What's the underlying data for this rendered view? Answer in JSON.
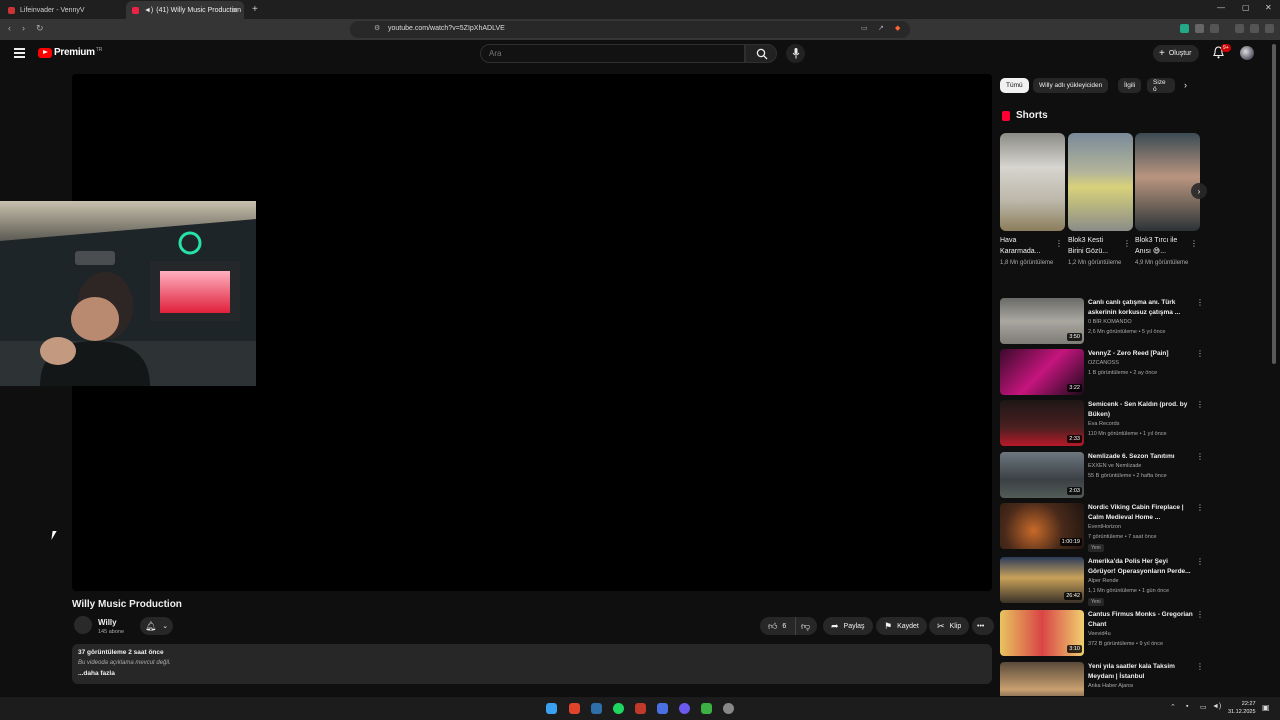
{
  "browser": {
    "tabs": [
      {
        "title": "Lifeinvader - VennyV"
      },
      {
        "title": "(41) Willy Music Production"
      }
    ],
    "url": "youtube.com/watch?v=5ZIpXhADLVE"
  },
  "header": {
    "logo": "Premium",
    "logo_region": "TR",
    "search_placeholder": "Ara",
    "create_label": "Oluştur",
    "notification_count": "9+"
  },
  "video": {
    "title": "Willy Music Production",
    "channel": "Willy",
    "subscribers": "145 abone",
    "likes": "6",
    "share_label": "Paylaş",
    "save_label": "Kaydet",
    "clip_label": "Klip",
    "description": {
      "views_date": "37 görüntüleme  2 saat önce",
      "text": "Bu videoda açıklama mevcut değil.",
      "more": "...daha fazla"
    }
  },
  "chips": [
    "Tümü",
    "Willy adlı yükleyiciden",
    "İlgili",
    "Size ö"
  ],
  "shorts": {
    "heading": "Shorts",
    "items": [
      {
        "title": "Hava Kararmada...",
        "views": "1,8 Mn görüntüleme"
      },
      {
        "title": "Blok3 Kesti Birini Gözü...",
        "views": "1,2 Mn görüntüleme"
      },
      {
        "title": "Blok3 Tırcı ile Anısı 😅...",
        "views": "4,9 Mn görüntüleme"
      }
    ]
  },
  "recommendations": [
    {
      "title": "Canlı canlı çatışma anı. Türk askerinin korkusuz çatışma ...",
      "channel": "0 BİR KOMANDO",
      "meta": "2,6 Mn görüntüleme • 5 yıl önce",
      "duration": "3:50"
    },
    {
      "title": "VennyZ - Zero Reed  [Pain]",
      "channel": "OZCANOSS",
      "meta": "1 B görüntüleme • 2 ay önce",
      "duration": "3:22"
    },
    {
      "title": "Semicenk - Sen Kaldın (prod. by Büken)",
      "channel": "Eva Records",
      "meta": "110 Mn görüntüleme • 1 yıl önce",
      "duration": "2:33"
    },
    {
      "title": "Nemlizade 6. Sezon Tanıtımı",
      "channel": "EXXEN ve Nemlizade",
      "meta": "55 B görüntüleme • 2 hafta önce",
      "duration": "2:03"
    },
    {
      "title": "Nordic Viking Cabin Fireplace | Calm Medieval Home ...",
      "channel": "EventHorizon",
      "meta": "7 görüntüleme • 7 saat önce",
      "duration": "1:00:19",
      "badge": "Yeni"
    },
    {
      "title": "Amerika'da Polis Her Şeyi Görüyor! Operasyonların Perde...",
      "channel": "Alper Rende",
      "meta": "1,1 Mn görüntüleme • 1 gün önce",
      "duration": "26:42",
      "badge": "Yeni"
    },
    {
      "title": "Cantus Firmus Monks - Gregorian Chant",
      "channel": "Veevid4u",
      "meta": "372 B görüntüleme • 9 yıl önce",
      "duration": "3:10"
    },
    {
      "title": "Yeni yıla saatler kala Taksim Meydanı | İstanbul",
      "channel": "Anka Haber Ajansı",
      "meta": "",
      "duration": ""
    }
  ],
  "taskbar": {
    "time": "22:27",
    "date": "31.12.2025"
  },
  "colors": {
    "background": "#0f0f0f",
    "brand": "#ff0000",
    "chip_active": "#f1f1f1"
  }
}
